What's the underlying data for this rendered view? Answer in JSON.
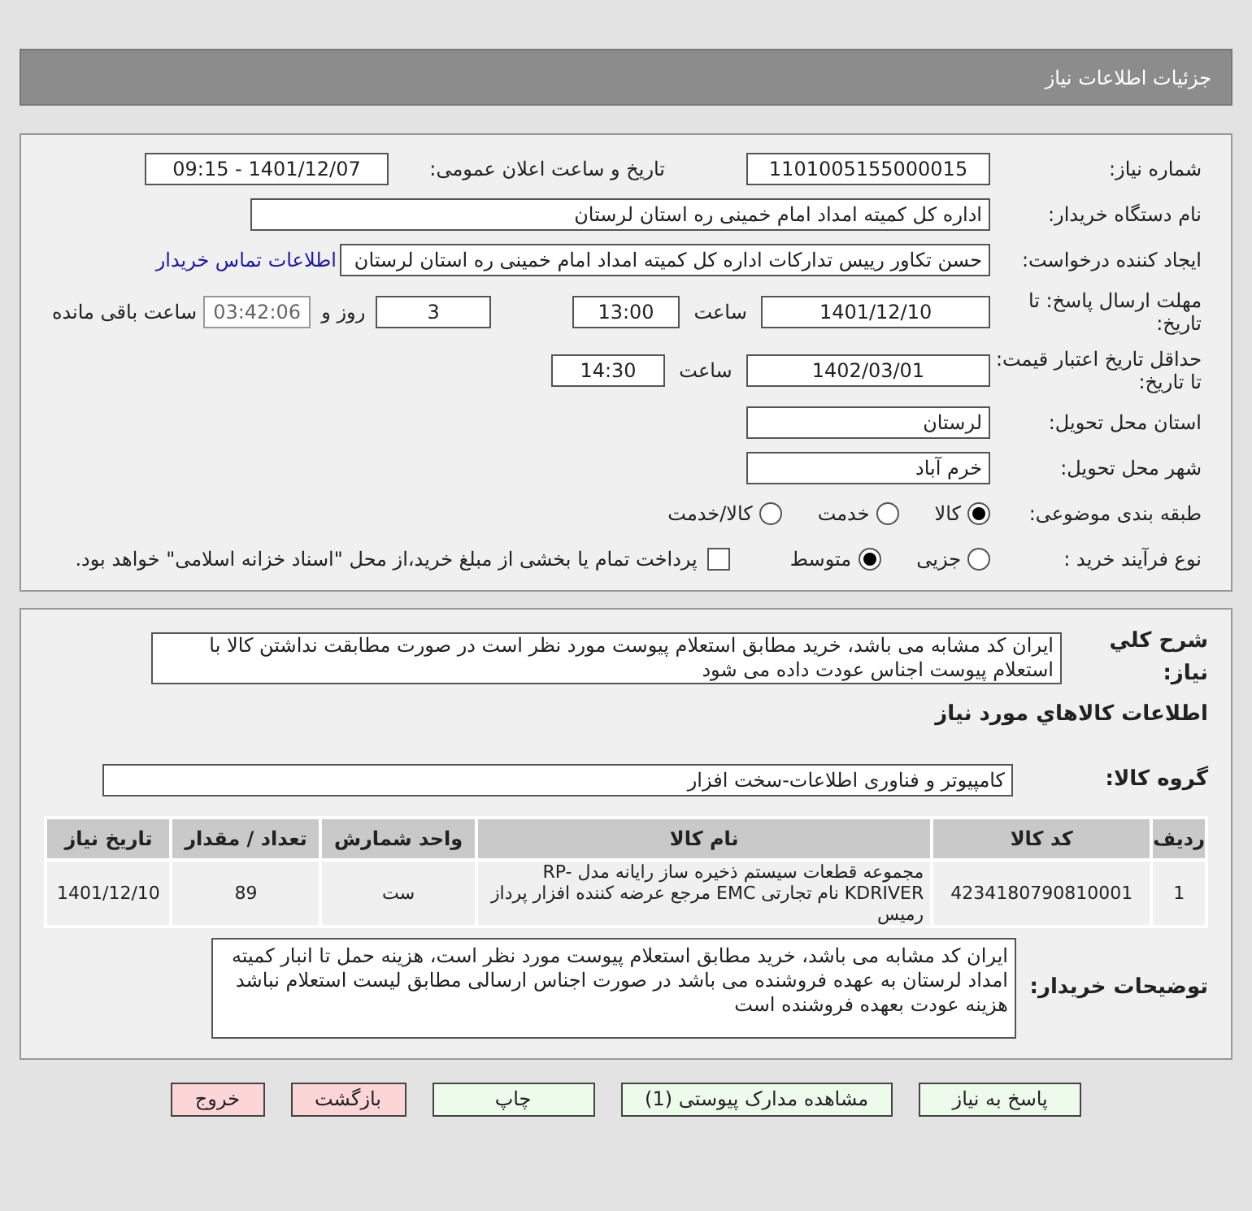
{
  "header": {
    "title": "جزئیات اطلاعات نیاز"
  },
  "need_number": {
    "label": "شماره نیاز:",
    "value": "1101005155000015"
  },
  "announce": {
    "label": "تاریخ و ساعت اعلان عمومی:",
    "value": "1401/12/07 - 09:15"
  },
  "buyer_org": {
    "label": "نام دستگاه خریدار:",
    "value": "اداره کل کمیته امداد امام خمینی  ره  استان لرستان"
  },
  "requester": {
    "label": "ایجاد کننده درخواست:",
    "value": "حسن تکاور رییس تدارکات اداره کل کمیته امداد امام خمینی  ره  استان لرستان",
    "link": "اطلاعات تماس خریدار"
  },
  "deadline": {
    "label": "مهلت ارسال پاسخ: تا تاریخ:",
    "date": "1401/12/10",
    "time_label": "ساعت",
    "time": "13:00",
    "days": "3",
    "days_label": "روز و",
    "remaining": "03:42:06",
    "remaining_label": "ساعت باقی مانده"
  },
  "validity": {
    "label": "حداقل تاریخ اعتبار قیمت: تا تاریخ:",
    "date": "1402/03/01",
    "time_label": "ساعت",
    "time": "14:30"
  },
  "province": {
    "label": "استان محل تحویل:",
    "value": "لرستان"
  },
  "city": {
    "label": "شهر محل تحویل:",
    "value": "خرم آباد"
  },
  "category": {
    "label": "طبقه بندی موضوعی:",
    "options": [
      {
        "label": "کالا",
        "selected": true
      },
      {
        "label": "خدمت",
        "selected": false
      },
      {
        "label": "کالا/خدمت",
        "selected": false
      }
    ]
  },
  "purchase_type": {
    "label": "نوع فرآیند خرید :",
    "options": [
      {
        "label": "جزیی",
        "selected": false
      },
      {
        "label": "متوسط",
        "selected": true
      }
    ],
    "payment": {
      "checked": false,
      "label": "پرداخت تمام یا بخشی از مبلغ خرید،از محل \"اسناد خزانه اسلامی\" خواهد بود."
    }
  },
  "description": {
    "label": "شرح كلي نياز:",
    "value": "ایران کد مشابه می باشد، خرید مطابق استعلام پیوست مورد نظر است در صورت مطابقت نداشتن کالا با استعلام پیوست اجناس عودت داده می شود"
  },
  "goods_title": "اطلاعات كالاهاي مورد نياز",
  "goods_group": {
    "label": "گروه کالا:",
    "value": "کامپیوتر و فناوری اطلاعات-سخت افزار"
  },
  "table": {
    "columns": [
      "ردیف",
      "کد کالا",
      "نام کالا",
      "واحد شمارش",
      "تعداد / مقدار",
      "تاریخ نیاز"
    ],
    "rows": [
      [
        "1",
        "4234180790810001",
        "مجموعه قطعات سیستم ذخیره ساز رایانه مدل RP-KDRIVER نام تجارتی EMC مرجع عرضه کننده افزار پرداز رمیس",
        "ست",
        "89",
        "1401/12/10"
      ]
    ]
  },
  "buyer_notes": {
    "label": "توضیحات خریدار:",
    "value": "ایران کد مشابه می باشد، خرید مطابق استعلام پیوست مورد نظر است، هزینه حمل تا انبار کمیته امداد لرستان به عهده فروشنده می باشد در صورت اجناس ارسالی مطابق لیست استعلام نباشد هزینه عودت بعهده فروشنده است"
  },
  "buttons": [
    {
      "label": "پاسخ به نیاز",
      "kind": "action"
    },
    {
      "label": "مشاهده مدارک پیوستی (1)",
      "kind": "action"
    },
    {
      "label": "چاپ",
      "kind": "action"
    },
    {
      "label": "بازگشت",
      "kind": "exit"
    },
    {
      "label": "خروج",
      "kind": "exit"
    }
  ]
}
